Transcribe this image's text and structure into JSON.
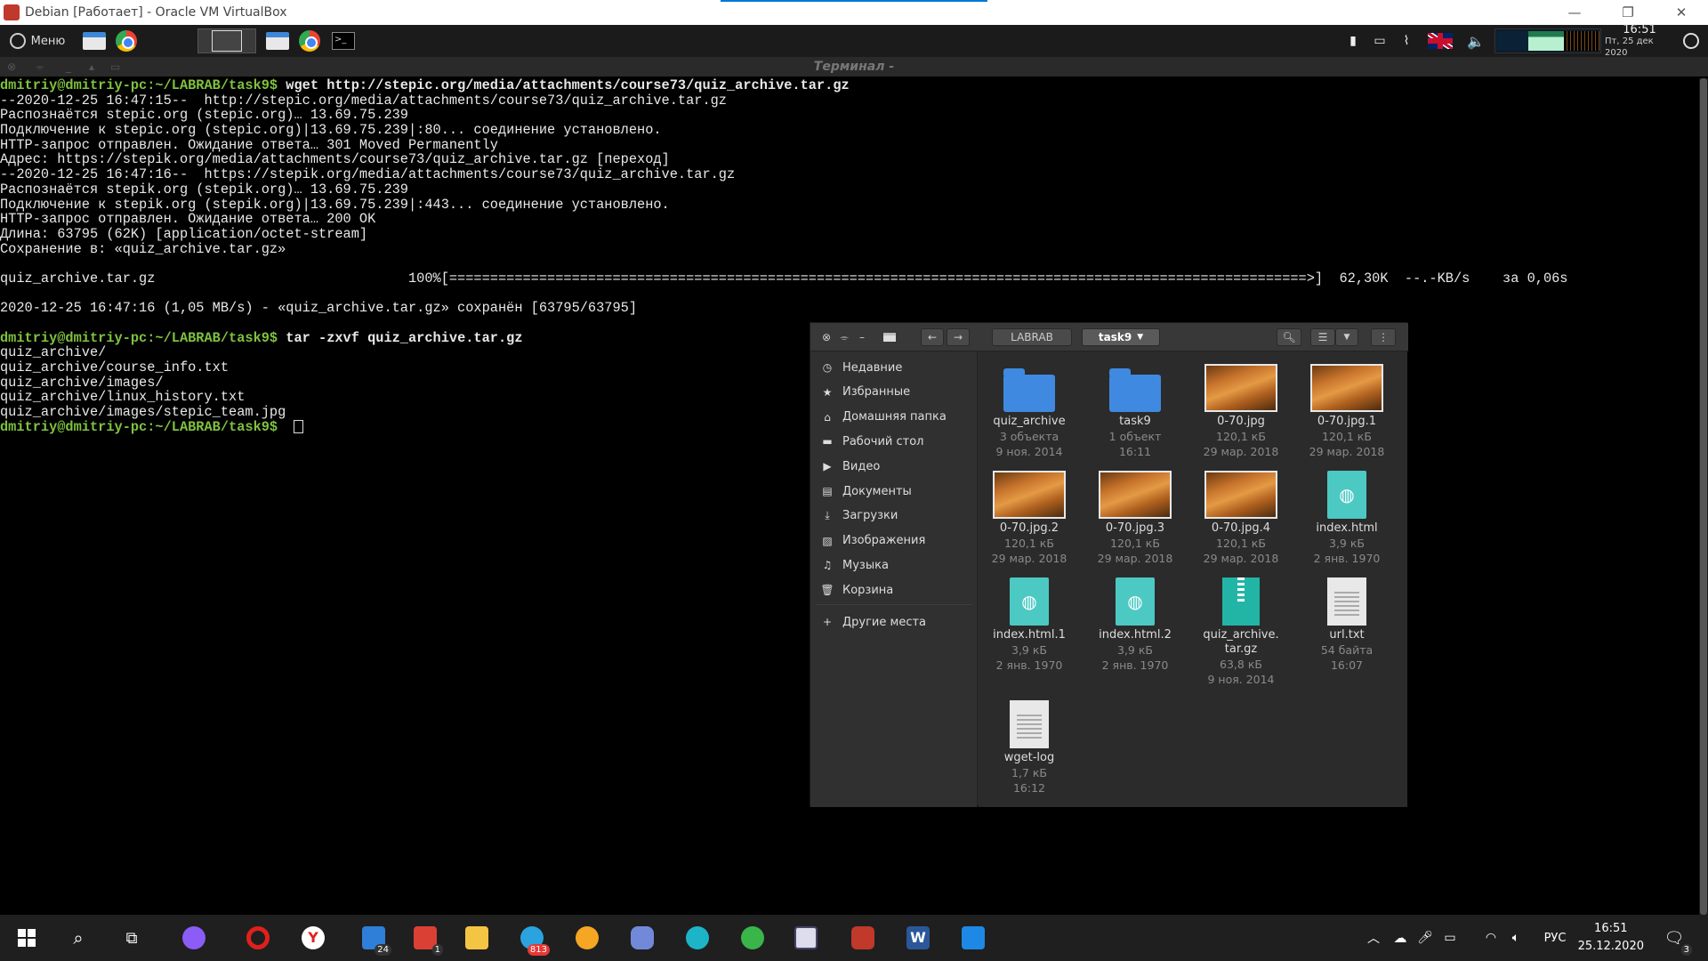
{
  "vbox": {
    "title": "Debian [Работает] - Oracle VM VirtualBox"
  },
  "panel": {
    "menu_label": "Меню",
    "clock_time": "16:51",
    "clock_date": "Пт, 25 дек 2020"
  },
  "terminal": {
    "title": "Терминал -",
    "lines": [
      {
        "prompt": "dmitriy@dmitriy-pc:~/LABRAB/task9$ ",
        "cmd": "wget http://stepic.org/media/attachments/course73/quiz_archive.tar.gz"
      },
      {
        "text": "--2020-12-25 16:47:15--  http://stepic.org/media/attachments/course73/quiz_archive.tar.gz"
      },
      {
        "text": "Распознаётся stepic.org (stepic.org)… 13.69.75.239"
      },
      {
        "text": "Подключение к stepic.org (stepic.org)|13.69.75.239|:80... соединение установлено."
      },
      {
        "text": "HTTP-запрос отправлен. Ожидание ответа… 301 Moved Permanently"
      },
      {
        "text": "Адрес: https://stepik.org/media/attachments/course73/quiz_archive.tar.gz [переход]"
      },
      {
        "text": "--2020-12-25 16:47:16--  https://stepik.org/media/attachments/course73/quiz_archive.tar.gz"
      },
      {
        "text": "Распознаётся stepik.org (stepik.org)… 13.69.75.239"
      },
      {
        "text": "Подключение к stepik.org (stepik.org)|13.69.75.239|:443... соединение установлено."
      },
      {
        "text": "HTTP-запрос отправлен. Ожидание ответа… 200 OK"
      },
      {
        "text": "Длина: 63795 (62K) [application/octet-stream]"
      },
      {
        "text": "Сохранение в: «quiz_archive.tar.gz»"
      },
      {
        "text": ""
      },
      {
        "text": "quiz_archive.tar.gz                               100%[=========================================================================================================>]  62,30K  --.-KB/s    за 0,06s"
      },
      {
        "text": ""
      },
      {
        "text": "2020-12-25 16:47:16 (1,05 MB/s) - «quiz_archive.tar.gz» сохранён [63795/63795]"
      },
      {
        "text": ""
      },
      {
        "prompt": "dmitriy@dmitriy-pc:~/LABRAB/task9$ ",
        "cmd": "tar -zxvf quiz_archive.tar.gz"
      },
      {
        "text": "quiz_archive/"
      },
      {
        "text": "quiz_archive/course_info.txt"
      },
      {
        "text": "quiz_archive/images/"
      },
      {
        "text": "quiz_archive/linux_history.txt"
      },
      {
        "text": "quiz_archive/images/stepic_team.jpg"
      },
      {
        "prompt": "dmitriy@dmitriy-pc:~/LABRAB/task9$ ",
        "cmd": " ",
        "cursor": true
      }
    ]
  },
  "file_manager": {
    "path": [
      "LABRAB",
      "task9"
    ],
    "sidebar": [
      {
        "label": "Недавние",
        "icon": "clock-icon"
      },
      {
        "label": "Избранные",
        "icon": "star-icon"
      },
      {
        "label": "Домашняя папка",
        "icon": "home-icon"
      },
      {
        "label": "Рабочий стол",
        "icon": "desktop-icon"
      },
      {
        "label": "Видео",
        "icon": "video-icon"
      },
      {
        "label": "Документы",
        "icon": "document-icon"
      },
      {
        "label": "Загрузки",
        "icon": "download-icon"
      },
      {
        "label": "Изображения",
        "icon": "image-icon"
      },
      {
        "label": "Музыка",
        "icon": "music-icon"
      },
      {
        "label": "Корзина",
        "icon": "trash-icon"
      },
      {
        "label": "Другие места",
        "icon": "plus-icon"
      }
    ],
    "files": [
      {
        "name": "quiz_archive",
        "meta1": "3 объекта",
        "meta2": "9 ноя. 2014",
        "kind": "folder"
      },
      {
        "name": "task9",
        "meta1": "1 объект",
        "meta2": "16:11",
        "kind": "folder"
      },
      {
        "name": "0-70.jpg",
        "meta1": "120,1 кБ",
        "meta2": "29 мар. 2018",
        "kind": "image"
      },
      {
        "name": "0-70.jpg.1",
        "meta1": "120,1 кБ",
        "meta2": "29 мар. 2018",
        "kind": "image"
      },
      {
        "name": "0-70.jpg.2",
        "meta1": "120,1 кБ",
        "meta2": "29 мар. 2018",
        "kind": "image"
      },
      {
        "name": "0-70.jpg.3",
        "meta1": "120,1 кБ",
        "meta2": "29 мар. 2018",
        "kind": "image"
      },
      {
        "name": "0-70.jpg.4",
        "meta1": "120,1 кБ",
        "meta2": "29 мар. 2018",
        "kind": "image"
      },
      {
        "name": "index.html",
        "meta1": "3,9 кБ",
        "meta2": "2 янв. 1970",
        "kind": "html"
      },
      {
        "name": "index.html.1",
        "meta1": "3,9 кБ",
        "meta2": "2 янв. 1970",
        "kind": "html"
      },
      {
        "name": "index.html.2",
        "meta1": "3,9 кБ",
        "meta2": "2 янв. 1970",
        "kind": "html"
      },
      {
        "name": "quiz_archive.\ntar.gz",
        "meta1": "63,8 кБ",
        "meta2": "9 ноя. 2014",
        "kind": "archive"
      },
      {
        "name": "url.txt",
        "meta1": "54 байта",
        "meta2": "16:07",
        "kind": "text"
      },
      {
        "name": "wget-log",
        "meta1": "1,7 кБ",
        "meta2": "16:12",
        "kind": "text"
      }
    ]
  },
  "taskbar": {
    "badges": {
      "files": "24",
      "tasks": "1",
      "telegram": "813",
      "notifications": "3"
    },
    "language": "РУС",
    "time": "16:51",
    "date": "25.12.2020"
  }
}
